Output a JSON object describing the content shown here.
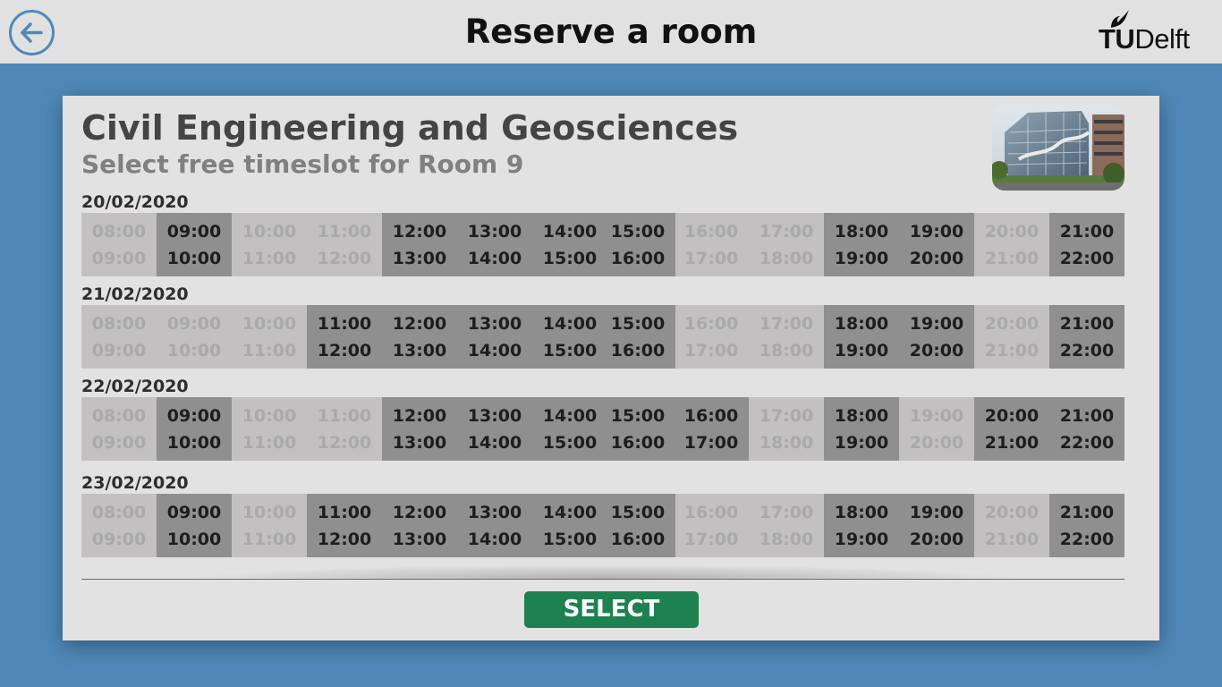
{
  "header": {
    "title": "Reserve a room",
    "logo_tu": "TU",
    "logo_delft": "Delft",
    "back_icon": "arrow-left-circle-icon"
  },
  "panel": {
    "building": "Civil Engineering and Geosciences",
    "subtitle": "Select free timeslot for Room 9",
    "photo_alt": "building-photo",
    "select_label": "SELECT",
    "colors": {
      "free_slot": "#8f8f8f",
      "busy_slot": "#c2c0c0",
      "select_button": "#1e8150",
      "background": "#4f88b8"
    }
  },
  "days": [
    {
      "date": "20/02/2020",
      "slots": [
        {
          "start": "08:00",
          "end": "09:00",
          "free": false
        },
        {
          "start": "09:00",
          "end": "10:00",
          "free": true
        },
        {
          "start": "10:00",
          "end": "11:00",
          "free": false
        },
        {
          "start": "11:00",
          "end": "12:00",
          "free": false
        },
        {
          "start": "12:00",
          "end": "13:00",
          "free": true
        },
        {
          "start": "13:00",
          "end": "14:00",
          "free": true
        },
        {
          "start": "14:00",
          "end": "15:00",
          "free": true
        },
        {
          "start": "15:00",
          "end": "16:00",
          "free": true
        },
        {
          "start": "16:00",
          "end": "17:00",
          "free": false
        },
        {
          "start": "17:00",
          "end": "18:00",
          "free": false
        },
        {
          "start": "18:00",
          "end": "19:00",
          "free": true
        },
        {
          "start": "19:00",
          "end": "20:00",
          "free": true
        },
        {
          "start": "20:00",
          "end": "21:00",
          "free": false
        },
        {
          "start": "21:00",
          "end": "22:00",
          "free": true
        }
      ]
    },
    {
      "date": "21/02/2020",
      "slots": [
        {
          "start": "08:00",
          "end": "09:00",
          "free": false
        },
        {
          "start": "09:00",
          "end": "10:00",
          "free": false
        },
        {
          "start": "10:00",
          "end": "11:00",
          "free": false
        },
        {
          "start": "11:00",
          "end": "12:00",
          "free": true
        },
        {
          "start": "12:00",
          "end": "13:00",
          "free": true
        },
        {
          "start": "13:00",
          "end": "14:00",
          "free": true
        },
        {
          "start": "14:00",
          "end": "15:00",
          "free": true
        },
        {
          "start": "15:00",
          "end": "16:00",
          "free": true
        },
        {
          "start": "16:00",
          "end": "17:00",
          "free": false
        },
        {
          "start": "17:00",
          "end": "18:00",
          "free": false
        },
        {
          "start": "18:00",
          "end": "19:00",
          "free": true
        },
        {
          "start": "19:00",
          "end": "20:00",
          "free": true
        },
        {
          "start": "20:00",
          "end": "21:00",
          "free": false
        },
        {
          "start": "21:00",
          "end": "22:00",
          "free": true
        }
      ]
    },
    {
      "date": "22/02/2020",
      "slots": [
        {
          "start": "08:00",
          "end": "09:00",
          "free": false
        },
        {
          "start": "09:00",
          "end": "10:00",
          "free": true
        },
        {
          "start": "10:00",
          "end": "11:00",
          "free": false
        },
        {
          "start": "11:00",
          "end": "12:00",
          "free": false
        },
        {
          "start": "12:00",
          "end": "13:00",
          "free": true
        },
        {
          "start": "13:00",
          "end": "14:00",
          "free": true
        },
        {
          "start": "14:00",
          "end": "15:00",
          "free": true
        },
        {
          "start": "15:00",
          "end": "16:00",
          "free": true
        },
        {
          "start": "16:00",
          "end": "17:00",
          "free": true
        },
        {
          "start": "17:00",
          "end": "18:00",
          "free": false
        },
        {
          "start": "18:00",
          "end": "19:00",
          "free": true
        },
        {
          "start": "19:00",
          "end": "20:00",
          "free": false
        },
        {
          "start": "20:00",
          "end": "21:00",
          "free": true
        },
        {
          "start": "21:00",
          "end": "22:00",
          "free": true
        }
      ]
    },
    {
      "date": "23/02/2020",
      "slots": [
        {
          "start": "08:00",
          "end": "09:00",
          "free": false
        },
        {
          "start": "09:00",
          "end": "10:00",
          "free": true
        },
        {
          "start": "10:00",
          "end": "11:00",
          "free": false
        },
        {
          "start": "11:00",
          "end": "12:00",
          "free": true
        },
        {
          "start": "12:00",
          "end": "13:00",
          "free": true
        },
        {
          "start": "13:00",
          "end": "14:00",
          "free": true
        },
        {
          "start": "14:00",
          "end": "15:00",
          "free": true
        },
        {
          "start": "15:00",
          "end": "16:00",
          "free": true
        },
        {
          "start": "16:00",
          "end": "17:00",
          "free": false
        },
        {
          "start": "17:00",
          "end": "18:00",
          "free": false
        },
        {
          "start": "18:00",
          "end": "19:00",
          "free": true
        },
        {
          "start": "19:00",
          "end": "20:00",
          "free": true
        },
        {
          "start": "20:00",
          "end": "21:00",
          "free": false
        },
        {
          "start": "21:00",
          "end": "22:00",
          "free": true
        }
      ]
    }
  ]
}
